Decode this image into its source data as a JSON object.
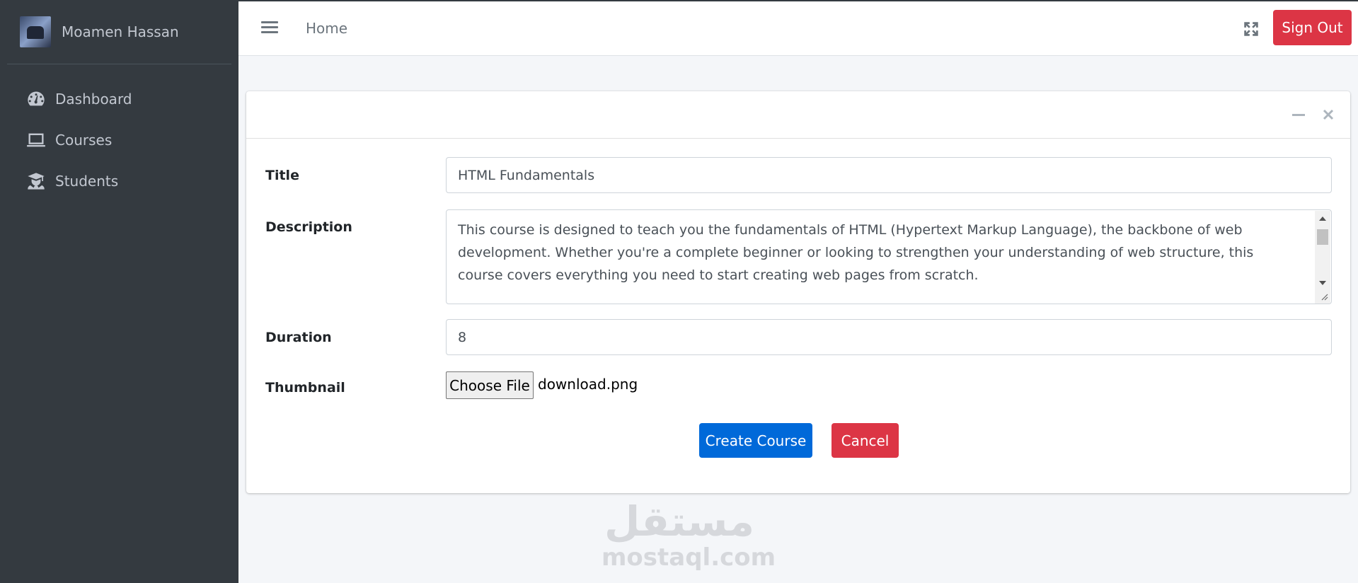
{
  "sidebar": {
    "user_name": "Moamen Hassan",
    "items": [
      {
        "label": "Dashboard",
        "icon": "tachometer-icon"
      },
      {
        "label": "Courses",
        "icon": "laptop-icon"
      },
      {
        "label": "Students",
        "icon": "user-graduate-icon"
      }
    ]
  },
  "topbar": {
    "home_label": "Home",
    "signout_label": "Sign Out"
  },
  "form": {
    "title_label": "Title",
    "title_value": "HTML Fundamentals",
    "description_label": "Description",
    "description_value": "This course is designed to teach you the fundamentals of HTML (Hypertext Markup Language), the backbone of web development. Whether you're a complete beginner or looking to strengthen your understanding of web structure, this course covers everything you need to start creating web pages from scratch.",
    "duration_label": "Duration",
    "duration_value": "8",
    "thumbnail_label": "Thumbnail",
    "choose_file_label": "Choose File",
    "file_name": "download.png",
    "create_label": "Create Course",
    "cancel_label": "Cancel"
  },
  "watermark": {
    "arabic": "مستقل",
    "latin": "mostaql.com"
  },
  "colors": {
    "sidebar_bg": "#343a40",
    "primary": "#0069d9",
    "danger": "#dc3545",
    "page_bg": "#f4f6f9"
  }
}
